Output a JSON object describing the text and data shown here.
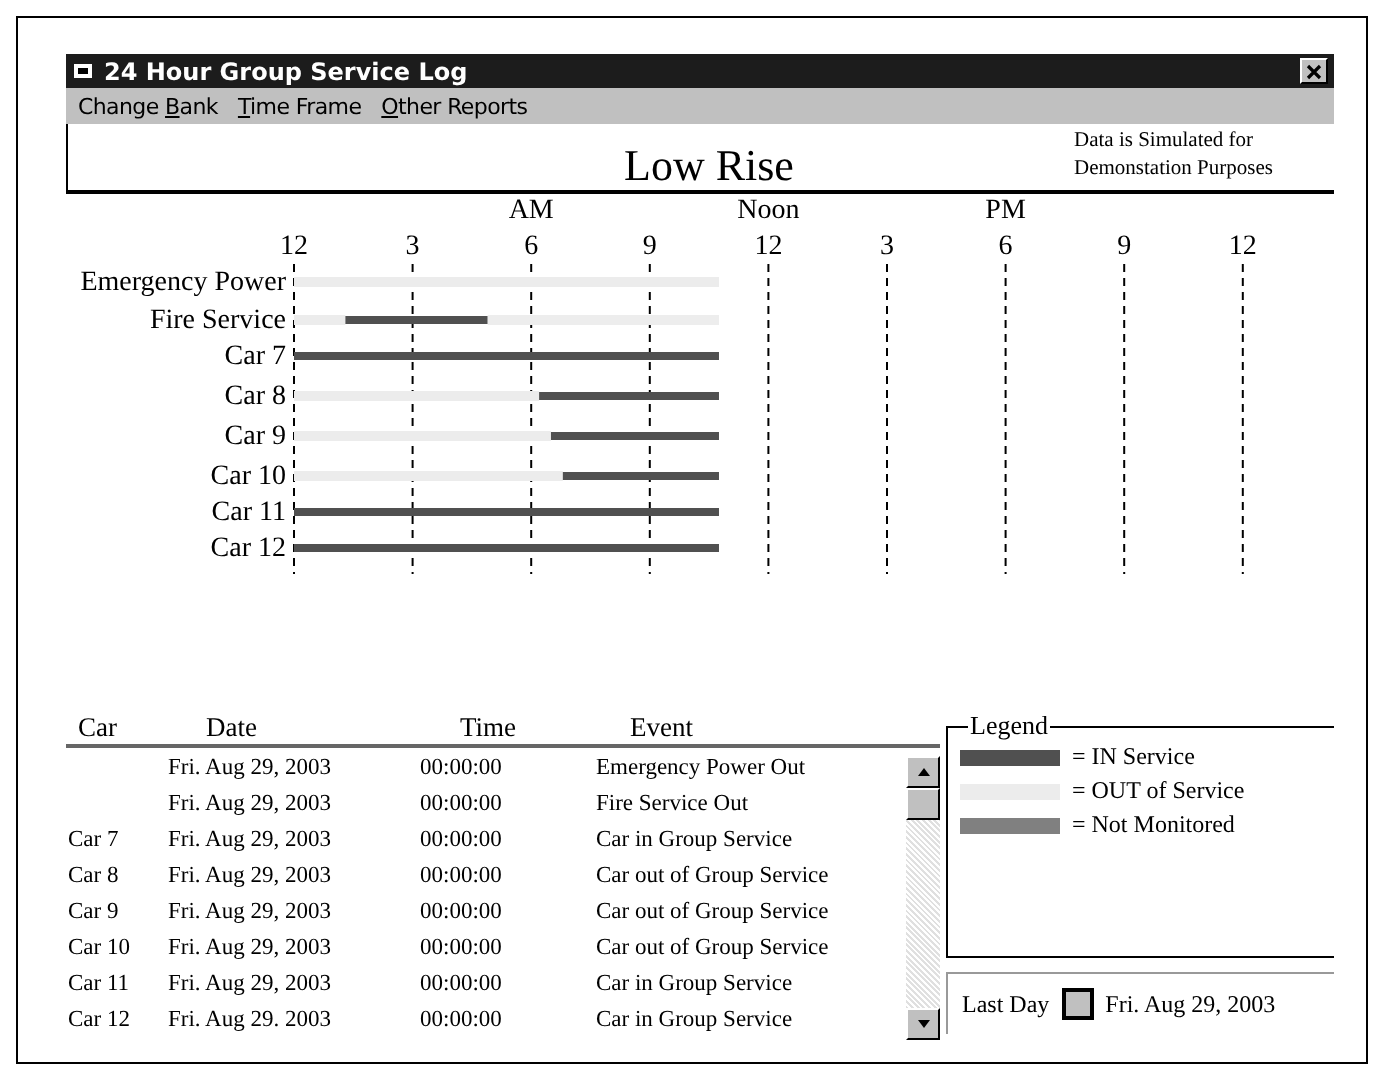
{
  "window": {
    "title": "24 Hour Group Service Log"
  },
  "menu": [
    {
      "before": "Change ",
      "access_key": "B",
      "after": "ank"
    },
    {
      "access_key": "T",
      "after": "ime Frame"
    },
    {
      "access_key": "O",
      "after": "ther Reports"
    }
  ],
  "header": {
    "title": "Low Rise",
    "note": "Data is Simulated for Demonstation Purposes"
  },
  "chart": {
    "period_labels": [
      "AM",
      "Noon",
      "PM"
    ],
    "other_hour_labels": [
      "12",
      "12",
      "3",
      "6",
      "9",
      "12"
    ],
    "chart_data": {
      "type": "bar",
      "orientation": "horizontal",
      "stacked": true,
      "grid": true,
      "xlim": [
        0,
        24
      ],
      "xticks": [
        3,
        6,
        9
      ],
      "categories": [
        "Emergency Power",
        "Fire Service",
        "Car 7",
        "Car 8",
        "Car 9",
        "Car 10",
        "Car 11",
        "Car 12"
      ],
      "series": [
        {
          "color": "#ececec",
          "values": [
            10.75,
            1.3,
            0,
            6.2,
            6.5,
            6.8,
            0,
            0
          ]
        },
        {
          "color": "#505050",
          "values": [
            0,
            3.6,
            10.75,
            4.55,
            4.25,
            3.95,
            10.75,
            10.75
          ]
        },
        {
          "color": "#ededed",
          "values": [
            0,
            5.85,
            0,
            0,
            0,
            0,
            0,
            0
          ]
        }
      ]
    }
  },
  "log": {
    "columns": [
      "Car",
      "Date",
      "Time",
      "Event"
    ],
    "rows": [
      [
        "",
        "Fri. Aug 29, 2003",
        "00:00:00",
        "Emergency Power Out"
      ],
      [
        "",
        "Fri. Aug 29, 2003",
        "00:00:00",
        "Fire Service Out"
      ],
      [
        "Car 7",
        "Fri. Aug 29, 2003",
        "00:00:00",
        "Car in Group Service"
      ],
      [
        "Car 8",
        "Fri. Aug 29, 2003",
        "00:00:00",
        "Car out of Group Service"
      ],
      [
        "Car 9",
        "Fri. Aug 29, 2003",
        "00:00:00",
        "Car out of Group Service"
      ],
      [
        "Car 10",
        "Fri. Aug 29, 2003",
        "00:00:00",
        "Car out of Group Service"
      ],
      [
        "Car 11",
        "Fri. Aug 29, 2003",
        "00:00:00",
        "Car in Group Service"
      ],
      [
        "Car 12",
        "Fri. Aug 29. 2003",
        "00:00:00",
        "Car in Group Service"
      ]
    ]
  },
  "legend": {
    "title": "Legend",
    "items": [
      {
        "label": "= IN Service",
        "color": "#505050"
      },
      {
        "label": "= OUT of Service",
        "color": "#ececec"
      },
      {
        "label": "= Not Monitored",
        "color": "#808080"
      }
    ]
  },
  "last_day": {
    "label": "Last Day",
    "checked": false,
    "date": "Fri. Aug 29, 2003"
  }
}
